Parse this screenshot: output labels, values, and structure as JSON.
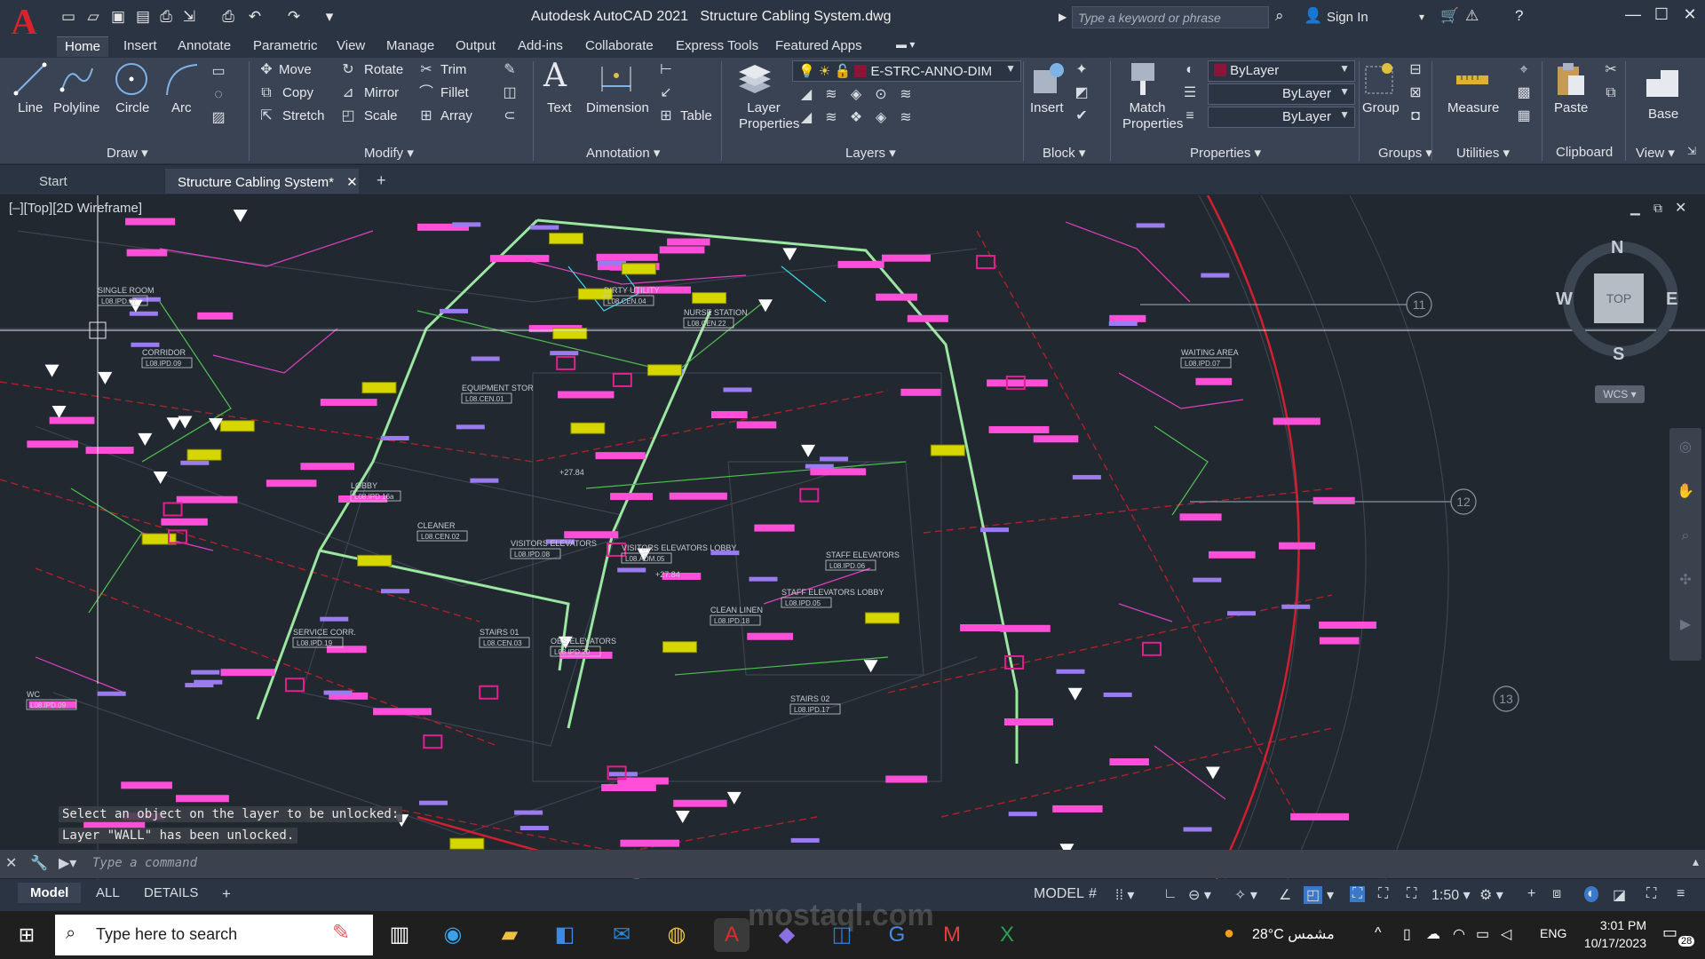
{
  "titlebar": {
    "app_name": "Autodesk AutoCAD 2021",
    "doc_name": "Structure Cabling System.dwg",
    "search_placeholder": "Type a keyword or phrase",
    "signin": "Sign In"
  },
  "ribbon_tabs": [
    "Home",
    "Insert",
    "Annotate",
    "Parametric",
    "View",
    "Manage",
    "Output",
    "Add-ins",
    "Collaborate",
    "Express Tools",
    "Featured Apps"
  ],
  "draw": {
    "title": "Draw",
    "line": "Line",
    "polyline": "Polyline",
    "circle": "Circle",
    "arc": "Arc"
  },
  "modify": {
    "title": "Modify",
    "move": "Move",
    "rotate": "Rotate",
    "trim": "Trim",
    "copy": "Copy",
    "mirror": "Mirror",
    "fillet": "Fillet",
    "stretch": "Stretch",
    "scale": "Scale",
    "array": "Array"
  },
  "annotation": {
    "title": "Annotation",
    "text": "Text",
    "dimension": "Dimension",
    "table": "Table"
  },
  "layers": {
    "title": "Layers",
    "layer_properties": "Layer Properties",
    "current_layer": "E-STRC-ANNO-DIM",
    "layer_color": "#8a1538"
  },
  "block": {
    "title": "Block",
    "insert": "Insert"
  },
  "properties": {
    "title": "Properties",
    "match": "Match Properties",
    "color": "ByLayer",
    "linetype": "ByLayer",
    "lineweight": "ByLayer"
  },
  "groups": {
    "title": "Groups",
    "group": "Group"
  },
  "utilities": {
    "title": "Utilities",
    "measure": "Measure"
  },
  "clipboard": {
    "title": "Clipboard",
    "paste": "Paste"
  },
  "view": {
    "title": "View",
    "base": "Base"
  },
  "doc_tabs": {
    "start": "Start",
    "active": "Structure Cabling System*"
  },
  "viewport": {
    "label": "[–][Top][2D Wireframe]",
    "compass": {
      "n": "N",
      "s": "S",
      "e": "E",
      "w": "W",
      "top": "TOP",
      "ucs": "WCS"
    },
    "grid_labels": [
      "11",
      "12",
      "13"
    ]
  },
  "drawing": {
    "room_labels": [
      "SINGLE ROOM",
      "CORRIDOR",
      "LOBBY",
      "NURSE STATION",
      "VISITORS ELEVATORS",
      "STAFF ELEVATORS",
      "STAFF ELEVATORS LOBBY",
      "STAIRS 01",
      "STAIRS 02",
      "CLEAN LINEN",
      "SERVICE CORR.",
      "OBS ELEVATORS",
      "EQUIPMENT STOR",
      "DIRTY UTILITY",
      "CLEANER",
      "VISITORS ELEVATORS LOBBY",
      "WAITING AREA",
      "WC"
    ],
    "tags": [
      "L08.IPD.07",
      "L08.IPD.09",
      "L08.IPD.16a",
      "L08.CEN.22",
      "L08.IPD.08",
      "L08.IPD.06",
      "L08.IPD.05",
      "L08.CEN.03",
      "L08.IPD.17",
      "L08.IPD.18",
      "L08.IPD.19",
      "L08.IPD.20",
      "L08.CEN.01",
      "L08.CEN.04",
      "L08.CEN.02",
      "L08.ADM.05"
    ],
    "levels": [
      "+27.84",
      "+27.84"
    ]
  },
  "command": {
    "history": [
      "Select an object on the layer to be unlocked:",
      "Layer \"WALL\" has been unlocked."
    ],
    "placeholder": "Type a command"
  },
  "layout_tabs": [
    "Model",
    "ALL",
    "DETAILS"
  ],
  "statusbar": {
    "model": "MODEL",
    "scale": "1:50"
  },
  "taskbar": {
    "search": "Type here to search",
    "weather": "28°C  مشمس",
    "lang": "ENG",
    "time": "3:01 PM",
    "date": "10/17/2023",
    "notifications": "28"
  },
  "watermark": "mostaql.com"
}
